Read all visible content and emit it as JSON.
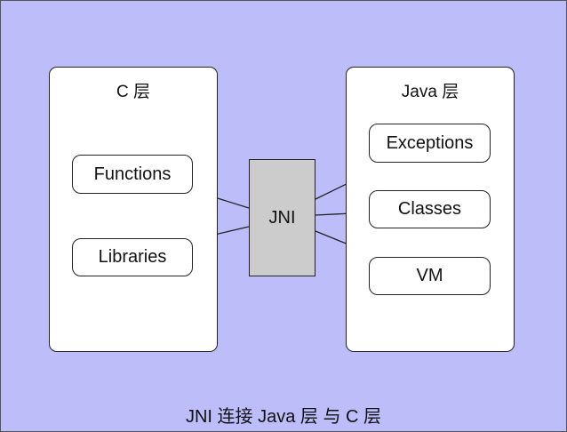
{
  "diagram": {
    "c_layer": {
      "title": "C 层",
      "nodes": [
        "Functions",
        "Libraries"
      ]
    },
    "java_layer": {
      "title": "Java 层",
      "nodes": [
        "Exceptions",
        "Classes",
        "VM"
      ]
    },
    "bridge": "JNI",
    "caption": "JNI 连接 Java 层 与 C 层",
    "colors": {
      "background": "#bdbdfa",
      "panel": "#ffffff",
      "bridge_fill": "#cccccc",
      "stroke": "#222222"
    }
  }
}
